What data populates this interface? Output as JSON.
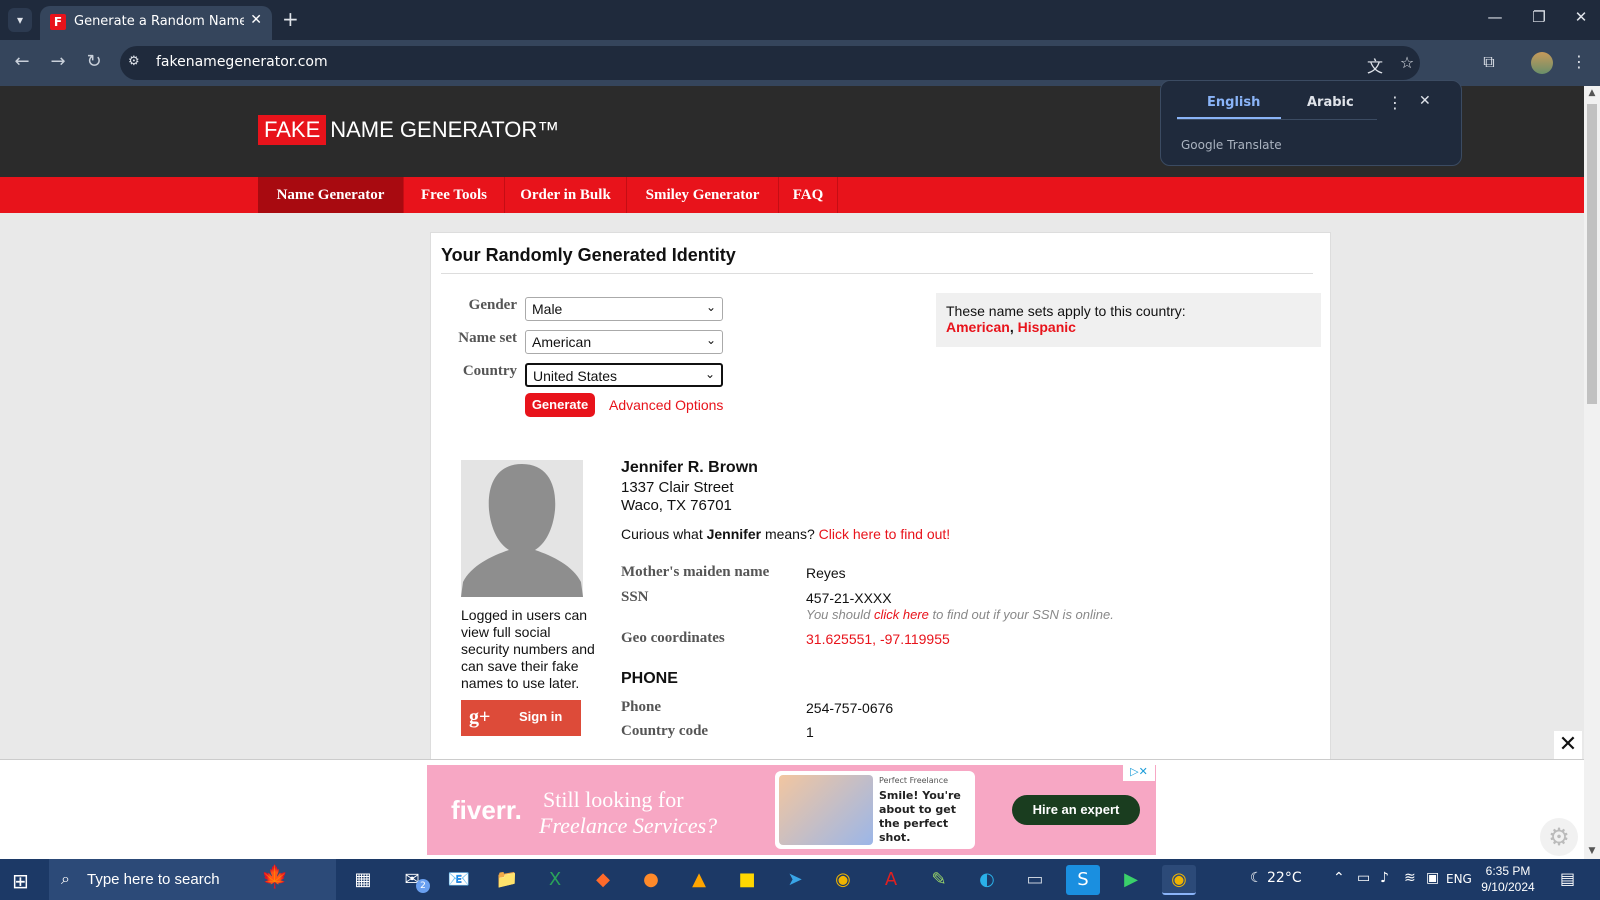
{
  "browser": {
    "tab_title": "Generate a Random Name - Fal",
    "url": "fakenamegenerator.com"
  },
  "translate": {
    "lang_active": "English",
    "lang_other": "Arabic",
    "brand": "Google Translate"
  },
  "site": {
    "logo_fake": "FAKE",
    "logo_rest": "NAME GENERATOR™",
    "nav": [
      "Name Generator",
      "Free Tools",
      "Order in Bulk",
      "Smiley Generator",
      "FAQ"
    ]
  },
  "form": {
    "title": "Your Randomly Generated Identity",
    "gender_label": "Gender",
    "gender_value": "Male",
    "nameset_label": "Name set",
    "nameset_value": "American",
    "country_label": "Country",
    "country_value": "United States",
    "generate_label": "Generate",
    "advanced_label": "Advanced Options"
  },
  "nameset_info": {
    "text": "These name sets apply to this country:",
    "link1": "American",
    "sep": ", ",
    "link2": "Hispanic"
  },
  "sidebar": {
    "login_note": "Logged in users can view full social security numbers and can save their fake names to use later.",
    "signin_icon": "g+",
    "signin_label": "Sign in"
  },
  "identity": {
    "name": "Jennifer R. Brown",
    "street": "1337 Clair Street",
    "city": "Waco, TX 76701",
    "meaning_prefix": "Curious what ",
    "meaning_name": "Jennifer",
    "meaning_suffix": " means? ",
    "meaning_link": "Click here to find out!",
    "fields": {
      "maiden_label": "Mother's maiden name",
      "maiden_value": "Reyes",
      "ssn_label": "SSN",
      "ssn_value": "457-21-XXXX",
      "ssn_note_prefix": "You should ",
      "ssn_note_link": "click here",
      "ssn_note_suffix": " to find out if your SSN is online.",
      "geo_label": "Geo coordinates",
      "geo_value": "31.625551, -97.119955"
    },
    "phone_section": "PHONE",
    "phone_label": "Phone",
    "phone_value": "254-757-0676",
    "cc_label": "Country code",
    "cc_value": "1"
  },
  "ad": {
    "logo": "fiverr.",
    "headline": "Still looking for",
    "subline": "Freelance Services?",
    "card_small": "Perfect Freelance",
    "card_text": "Smile! You're about to get the perfect shot.",
    "cta": "Hire an expert"
  },
  "taskbar": {
    "search_placeholder": "Type here to search",
    "weather": "22°C",
    "lang": "ENG",
    "time": "6:35 PM",
    "date": "9/10/2024",
    "mail_badge": "2"
  },
  "colors": {
    "brand_red": "#e8131b",
    "header_dark": "#2b2b2b",
    "chrome_dark": "#1f2a3c"
  }
}
